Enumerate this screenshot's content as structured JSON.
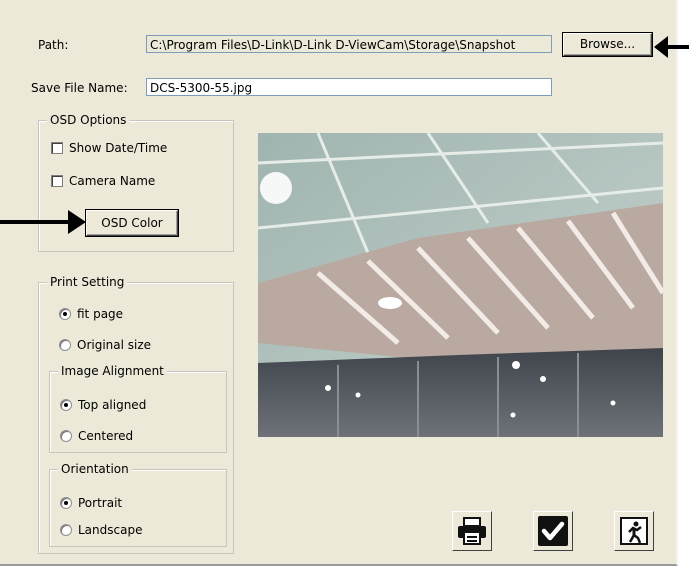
{
  "path": {
    "label": "Path:",
    "value": "C:\\Program Files\\D-Link\\D-Link D-ViewCam\\Storage\\Snapshot",
    "browse_label": "Browse..."
  },
  "save_file": {
    "label": "Save File Name:",
    "value": "DCS-5300-55.jpg"
  },
  "osd": {
    "title": "OSD Options",
    "show_datetime": {
      "label": "Show Date/Time",
      "checked": false
    },
    "camera_name": {
      "label": "Camera Name",
      "checked": false
    },
    "color_button": "OSD Color"
  },
  "print": {
    "title": "Print Setting",
    "fit_page": {
      "label": "fit page",
      "selected": true
    },
    "original_size": {
      "label": "Original size",
      "selected": false
    },
    "alignment": {
      "title": "Image Alignment",
      "top": {
        "label": "Top aligned",
        "selected": true
      },
      "centered": {
        "label": "Centered",
        "selected": false
      }
    },
    "orientation": {
      "title": "Orientation",
      "portrait": {
        "label": "Portrait",
        "selected": true
      },
      "landscape": {
        "label": "Landscape",
        "selected": false
      }
    }
  },
  "actions": {
    "print_icon": "printer-icon",
    "ok_icon": "checkmark-icon",
    "exit_icon": "exit-door-icon"
  },
  "colors": {
    "dialog_bg": "#ece9d8",
    "field_border": "#7f9db9"
  }
}
